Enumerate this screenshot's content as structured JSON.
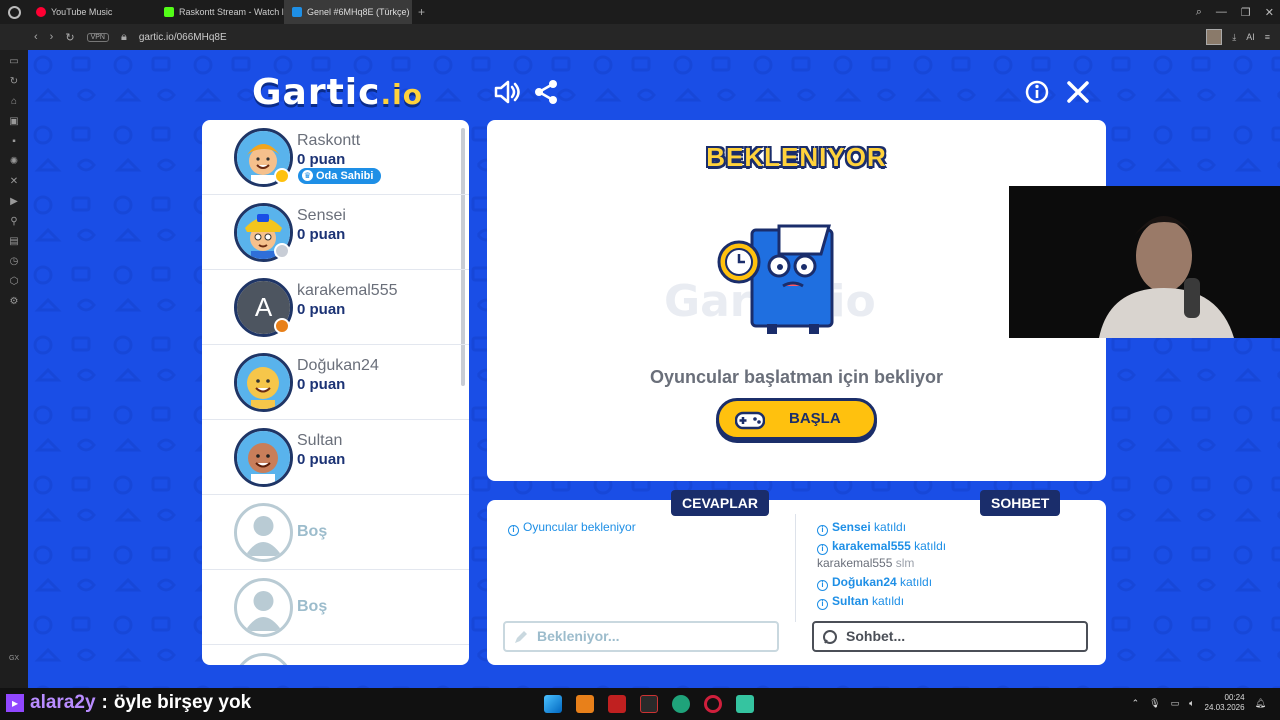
{
  "browser": {
    "tabs": [
      {
        "label": "YouTube Music",
        "color": "#ff0033"
      },
      {
        "label": "Raskontt Stream - Watch l",
        "color": "#53fc18"
      },
      {
        "label": "Genel #6MHq8E (Türkçe)",
        "color": "#1e8fe6"
      }
    ],
    "new_tab": "+",
    "vpn_badge": "VPN",
    "url": "gartic.io/066MHq8E",
    "ai_label": "AI"
  },
  "game": {
    "logo_main": "Gartic",
    "logo_suffix": ".io",
    "status_title": "BEKLENIYOR",
    "waiting_message": "Oyuncular başlatman için bekliyor",
    "start_button": "BAŞLA"
  },
  "players": [
    {
      "name": "Raskontt",
      "points": "0 puan",
      "badge": "Oda Sahibi",
      "status_color": "#ffc10e",
      "avatar": "boy-blonde"
    },
    {
      "name": "Sensei",
      "points": "0 puan",
      "status_color": "#c8cdd6",
      "avatar": "cap"
    },
    {
      "name": "karakemal555",
      "points": "0 puan",
      "status_color": "#e8801a",
      "avatar": "letter",
      "letter": "A"
    },
    {
      "name": "Doğukan24",
      "points": "0 puan",
      "avatar": "bald"
    },
    {
      "name": "Sultan",
      "points": "0 puan",
      "avatar": "dark"
    },
    {
      "name": "Boş",
      "empty": true
    },
    {
      "name": "Boş",
      "empty": true
    }
  ],
  "answers": {
    "header": "CEVAPLAR",
    "messages": [
      {
        "text": "Oyuncular bekleniyor"
      }
    ],
    "placeholder": "Bekleniyor..."
  },
  "chat": {
    "header": "SOHBET",
    "messages": [
      {
        "user": "Sensei",
        "text": "katıldı"
      },
      {
        "user": "karakemal555",
        "text": "katıldı"
      },
      {
        "user": "karakemal555",
        "text": "slm",
        "plain": true
      },
      {
        "user": "Doğukan24",
        "text": "katıldı"
      },
      {
        "user": "Sultan",
        "text": "katıldı"
      }
    ],
    "placeholder": "Sohbet..."
  },
  "stream_overlay": {
    "user": "alara2y",
    "separator": " : ",
    "message": "öyle birşey yok"
  },
  "taskbar": {
    "time": "00:24",
    "date": "24.03.2026"
  },
  "colors": {
    "page_bg": "#1a4ee6",
    "navy": "#1a2d6b",
    "yellow": "#ffc10e",
    "blue_text": "#1e8fe6"
  }
}
